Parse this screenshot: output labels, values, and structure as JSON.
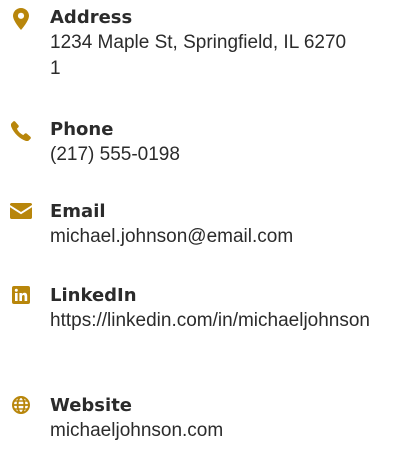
{
  "accent_color": "#b8860b",
  "items": [
    {
      "icon": "map-pin-icon",
      "label": "Address",
      "value": "1234 Maple St, Springfield, IL 62701"
    },
    {
      "icon": "phone-icon",
      "label": "Phone",
      "value": "(217) 555-0198"
    },
    {
      "icon": "envelope-icon",
      "label": "Email",
      "value": "michael.johnson@email.com"
    },
    {
      "icon": "linkedin-icon",
      "label": "LinkedIn",
      "value": "https://linkedin.com/in/michaeljohnson"
    },
    {
      "icon": "globe-icon",
      "label": "Website",
      "value": "michaeljohnson.com"
    }
  ]
}
